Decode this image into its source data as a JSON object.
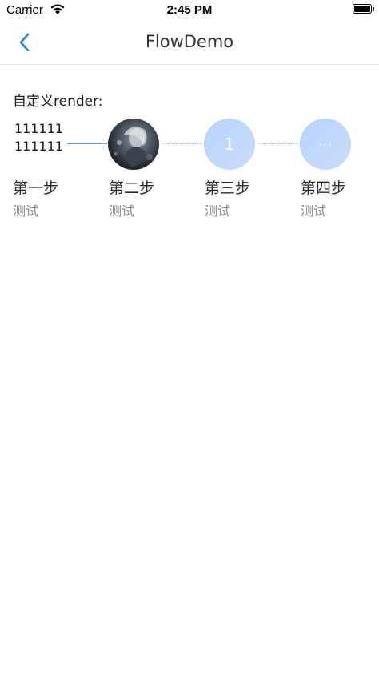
{
  "status_bar": {
    "carrier": "Carrier",
    "time": "2:45 PM",
    "icons": [
      "wifi-icon",
      "battery-icon"
    ]
  },
  "nav": {
    "title": "FlowDemo",
    "back_icon": "chevron-left-icon",
    "accent_color": "#2f7de1"
  },
  "section": {
    "label": "自定义render:"
  },
  "steps": [
    {
      "custom_text": "111111111111",
      "title": "第一步",
      "desc": "测试"
    },
    {
      "icon": "avatar-image",
      "title": "第二步",
      "desc": "测试"
    },
    {
      "number": "1",
      "title": "第三步",
      "desc": "测试"
    },
    {
      "more": "···",
      "title": "第四步",
      "desc": "测试"
    }
  ],
  "colors": {
    "line_active": "#6f9fe0",
    "line_inactive": "#9bbfee",
    "node_fill": "#b6d3ff",
    "desc_text": "#888888"
  }
}
